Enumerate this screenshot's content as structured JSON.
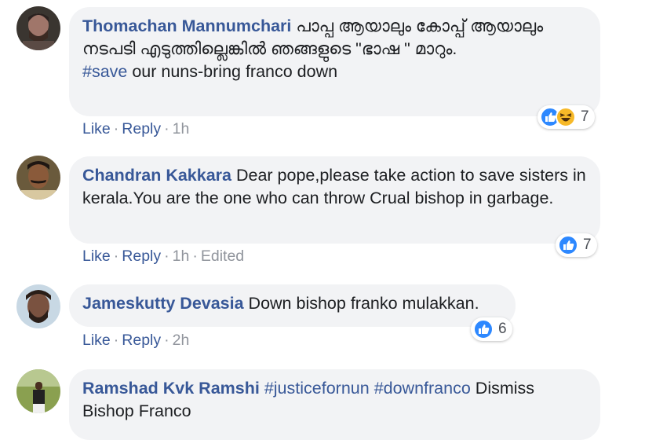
{
  "comments": [
    {
      "author": "Thomachan Mannumchari",
      "text": " പാപ്പ ആയാലും കോപ്പ് ആയാലും നടപടി എടുത്തില്ലെങ്കിൽ ഞങ്ങളുടെ \"ഭാഷ \" മാറും.",
      "hashtag": "#save",
      "text2": " our nuns-bring franco down",
      "like_label": "Like",
      "reply_label": "Reply",
      "time": "1h",
      "reaction_count": "7",
      "reaction_icons": [
        "like-icon",
        "haha-icon"
      ]
    },
    {
      "author": "Chandran Kakkara",
      "text": " Dear pope,please take action to save sisters in kerala.You are the one who can throw Crual bishop in garbage.",
      "like_label": "Like",
      "reply_label": "Reply",
      "time": "1h",
      "edited": "Edited",
      "reaction_count": "7",
      "reaction_icons": [
        "like-icon"
      ]
    },
    {
      "author": "Jameskutty Devasia",
      "text": " Down bishop franko mulakkan.",
      "like_label": "Like",
      "reply_label": "Reply",
      "time": "2h",
      "reaction_count": "6",
      "reaction_icons": [
        "like-icon"
      ]
    },
    {
      "author": "Ramshad Kvk Ramshi",
      "hashtag1": "#justicefornun",
      "hashtag2": "#downfranco",
      "text": " Dismiss Bishop Franco"
    }
  ],
  "separator": "·",
  "colors": {
    "author": "#385898",
    "bubble": "#f2f3f5",
    "meta": "#90949c",
    "like_blue": "#2d88ff",
    "haha_yellow": "#f7b928"
  }
}
